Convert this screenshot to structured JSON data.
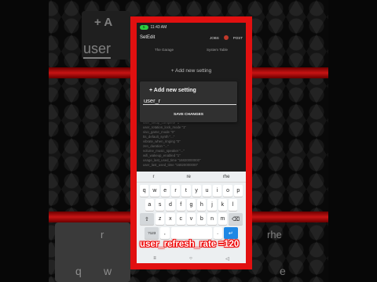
{
  "statusbar": {
    "pill": "5",
    "time": "11:43 AM"
  },
  "appbar": {
    "title": "SetEdit",
    "action_jobs": "JOBS",
    "action_post": "POST"
  },
  "filters": {
    "left": "The Garage",
    "right": "System Table"
  },
  "add_label": "+ Add new setting",
  "dialog": {
    "title": "+ Add new setting",
    "input_value": "user_r",
    "save_label": "SAVE CHANGES"
  },
  "list_items": [
    "user_setup_complete \"1\"",
    "user_rotation_lock_mode \"1\"",
    "vivo_game_mode \"0\"",
    "tts_default_synth \"...\"",
    "vibrate_when_ringing \"0\"",
    "zen_duration \"...\"",
    "volume_music_speaker \"...\"",
    "wifi_wakeup_enabled \"1\"",
    "usage_last_used_time \"16820000000\"",
    "user_last_used_time \"16820000000\""
  ],
  "keyboard": {
    "suggestions": [
      "r",
      "re",
      "rhe"
    ],
    "row1": [
      "q",
      "w",
      "e",
      "r",
      "t",
      "y",
      "u",
      "i",
      "o",
      "p"
    ],
    "row2": [
      "a",
      "s",
      "d",
      "f",
      "g",
      "h",
      "j",
      "k",
      "l"
    ],
    "row3": [
      "z",
      "x",
      "c",
      "v",
      "b",
      "n",
      "m"
    ],
    "shift": "⇧",
    "backspace": "⌫",
    "sym": "?123",
    "comma": ",",
    "space": "",
    "period": ".",
    "enter": "↵"
  },
  "nav": {
    "menu": "≡",
    "home": "○",
    "back": "◁"
  },
  "background_text": {
    "top_heading": "+ A",
    "input": "user",
    "suggestions": [
      "r",
      "rhe"
    ],
    "keys": [
      "q",
      "w",
      "e"
    ]
  },
  "caption": "user_refresh_rate =120"
}
